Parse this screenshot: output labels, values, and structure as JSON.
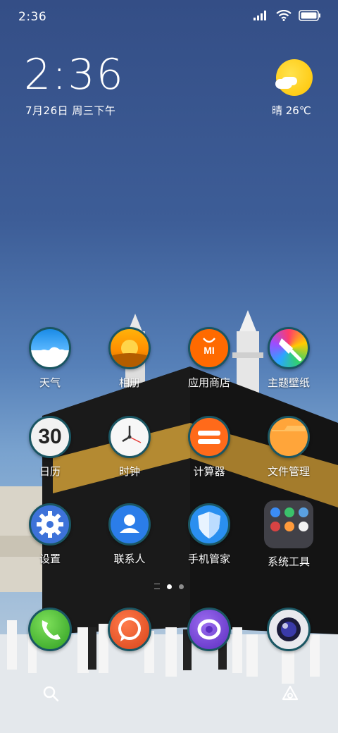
{
  "status_bar": {
    "time": "2:36",
    "icons": [
      "signal-icon",
      "wifi-icon",
      "battery-icon"
    ]
  },
  "clock_widget": {
    "time": "2:36",
    "date": "7月26日 周三下午"
  },
  "weather_widget": {
    "condition_icon": "sunny-cloud-icon",
    "text": "晴 26℃"
  },
  "apps": [
    {
      "name": "weather",
      "label": "天气",
      "icon": "weather-app-icon"
    },
    {
      "name": "gallery",
      "label": "相册",
      "icon": "gallery-app-icon"
    },
    {
      "name": "app-store",
      "label": "应用商店",
      "icon": "mi-store-icon"
    },
    {
      "name": "themes",
      "label": "主题壁纸",
      "icon": "themes-brush-icon"
    },
    {
      "name": "calendar",
      "label": "日历",
      "icon": "calendar-app-icon",
      "calendar_day": "30"
    },
    {
      "name": "clock",
      "label": "时钟",
      "icon": "clock-app-icon"
    },
    {
      "name": "calculator",
      "label": "计算器",
      "icon": "calculator-app-icon"
    },
    {
      "name": "file-manager",
      "label": "文件管理",
      "icon": "folder-app-icon"
    },
    {
      "name": "settings",
      "label": "设置",
      "icon": "gear-icon"
    },
    {
      "name": "contacts",
      "label": "联系人",
      "icon": "contacts-person-icon"
    },
    {
      "name": "security",
      "label": "手机管家",
      "icon": "shield-icon"
    },
    {
      "name": "system-tools",
      "label": "系统工具",
      "icon": "folder-grid-icon"
    }
  ],
  "page_indicator": {
    "pages": 2,
    "active": 1
  },
  "dock": [
    {
      "name": "phone",
      "icon": "phone-icon"
    },
    {
      "name": "messages",
      "icon": "message-bubble-icon"
    },
    {
      "name": "browser",
      "icon": "browser-orbit-icon"
    },
    {
      "name": "camera",
      "icon": "camera-lens-icon"
    }
  ],
  "bottom_bar": [
    "search-icon",
    "assistant-icon"
  ],
  "colors": {
    "sky_top": "#344e86",
    "kaaba": "#141414",
    "gold_band": "#b48a32",
    "icon_ring": "#1a5663"
  }
}
